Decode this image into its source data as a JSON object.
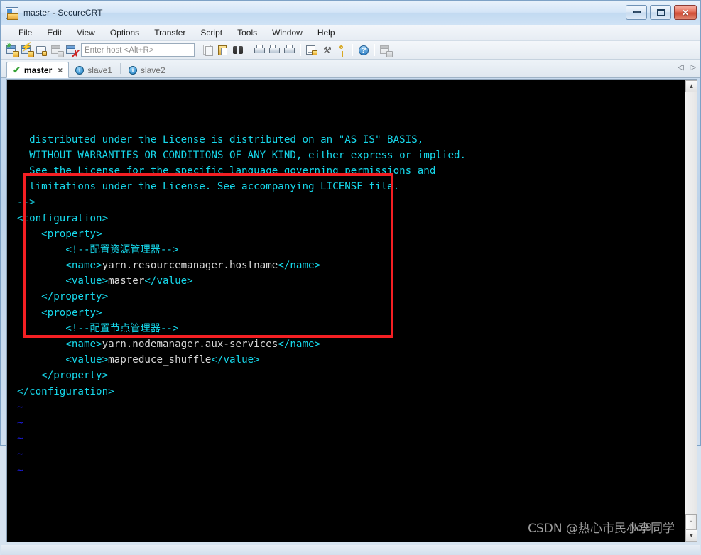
{
  "window": {
    "title": "master - SecureCRT",
    "icon": "securecrt-app-icon",
    "controls": {
      "minimize": "minimize-icon",
      "maximize": "maximize-icon",
      "close": "✕"
    }
  },
  "menubar": {
    "items": [
      "File",
      "Edit",
      "View",
      "Options",
      "Transfer",
      "Script",
      "Tools",
      "Window",
      "Help"
    ]
  },
  "toolbar": {
    "host_placeholder": "Enter host <Alt+R>",
    "icons": [
      "new-session-icon",
      "quick-connect-icon",
      "connect-in-tab-icon",
      "reconnect-icon",
      "disconnect-icon",
      "copy-icon",
      "paste-icon",
      "find-icon",
      "print-screen-icon",
      "log-session-icon",
      "print-icon",
      "session-options-icon",
      "session-settings-icon",
      "key-icon",
      "help-icon",
      "arrange-windows-icon"
    ]
  },
  "tabs": {
    "items": [
      {
        "label": "master",
        "active": true,
        "status": "connected",
        "closable": true
      },
      {
        "label": "slave1",
        "active": false,
        "status": "info",
        "closable": false
      },
      {
        "label": "slave2",
        "active": false,
        "status": "info",
        "closable": false
      }
    ],
    "nav_prev": "◁",
    "nav_next": "▷",
    "close_glyph": "×",
    "check_glyph": "✔",
    "info_glyph": "i"
  },
  "terminal": {
    "colors": {
      "background": "#000000",
      "tag": "#16d7ea",
      "text": "#d8d8d8",
      "tilde": "#1c1ce0"
    },
    "lines": [
      {
        "indent": 2,
        "parts": [
          {
            "t": "distributed under the License is distributed on an \"AS IS\" BASIS,",
            "c": "cy"
          }
        ]
      },
      {
        "indent": 2,
        "parts": [
          {
            "t": "WITHOUT WARRANTIES OR CONDITIONS OF ANY KIND, either express or implied.",
            "c": "cy"
          }
        ]
      },
      {
        "indent": 2,
        "parts": [
          {
            "t": "See the License for the specific language governing permissions and",
            "c": "cy"
          }
        ]
      },
      {
        "indent": 2,
        "parts": [
          {
            "t": "limitations under the License. See accompanying LICENSE file.",
            "c": "cy"
          }
        ]
      },
      {
        "indent": 0,
        "parts": [
          {
            "t": "-->",
            "c": "cy"
          }
        ]
      },
      {
        "indent": 0,
        "parts": [
          {
            "t": "<configuration>",
            "c": "cy"
          }
        ]
      },
      {
        "indent": 4,
        "parts": [
          {
            "t": "<property>",
            "c": "cy"
          }
        ]
      },
      {
        "indent": 8,
        "parts": [
          {
            "t": "<!--配置资源管理器-->",
            "c": "cy"
          }
        ]
      },
      {
        "indent": 8,
        "parts": [
          {
            "t": "<name>",
            "c": "cy"
          },
          {
            "t": "yarn.resourcemanager.hostname",
            "c": "wh"
          },
          {
            "t": "</name>",
            "c": "cy"
          }
        ]
      },
      {
        "indent": 8,
        "parts": [
          {
            "t": "<value>",
            "c": "cy"
          },
          {
            "t": "master",
            "c": "wh"
          },
          {
            "t": "</value>",
            "c": "cy"
          }
        ]
      },
      {
        "indent": 4,
        "parts": [
          {
            "t": "</property>",
            "c": "cy"
          }
        ]
      },
      {
        "indent": 4,
        "parts": [
          {
            "t": "<property>",
            "c": "cy"
          }
        ]
      },
      {
        "indent": 8,
        "parts": [
          {
            "t": "<!--配置节点管理器-->",
            "c": "cy"
          }
        ]
      },
      {
        "indent": 8,
        "parts": [
          {
            "t": "<name>",
            "c": "cy"
          },
          {
            "t": "yarn.nodemanager.aux-services",
            "c": "wh"
          },
          {
            "t": "</name>",
            "c": "cy"
          }
        ]
      },
      {
        "indent": 8,
        "parts": [
          {
            "t": "<value>",
            "c": "cy"
          },
          {
            "t": "mapreduce_shuffle",
            "c": "wh"
          },
          {
            "t": "</value>",
            "c": "cy"
          }
        ]
      },
      {
        "indent": 4,
        "parts": [
          {
            "t": "</property>",
            "c": "cy"
          }
        ]
      },
      {
        "indent": 0,
        "parts": [
          {
            "t": "</configuration>",
            "c": "cy"
          }
        ]
      },
      {
        "indent": 0,
        "parts": [
          {
            "t": "~",
            "c": "bl"
          }
        ]
      },
      {
        "indent": 0,
        "parts": [
          {
            "t": "~",
            "c": "bl"
          }
        ]
      },
      {
        "indent": 0,
        "parts": [
          {
            "t": "~",
            "c": "bl"
          }
        ]
      },
      {
        "indent": 0,
        "parts": [
          {
            "t": "~",
            "c": "bl"
          }
        ]
      },
      {
        "indent": 0,
        "parts": [
          {
            "t": "~",
            "c": "bl"
          }
        ]
      }
    ]
  },
  "annotation": {
    "redbox_color": "#f41f23",
    "label": "highlighted-configuration-block"
  },
  "watermark": {
    "text": "CSDN @热心市民小李同学",
    "overlay_text": "No.9"
  },
  "scrollbar": {
    "up_arrow": "▲",
    "down_arrow": "▼",
    "thumb": "≡"
  }
}
